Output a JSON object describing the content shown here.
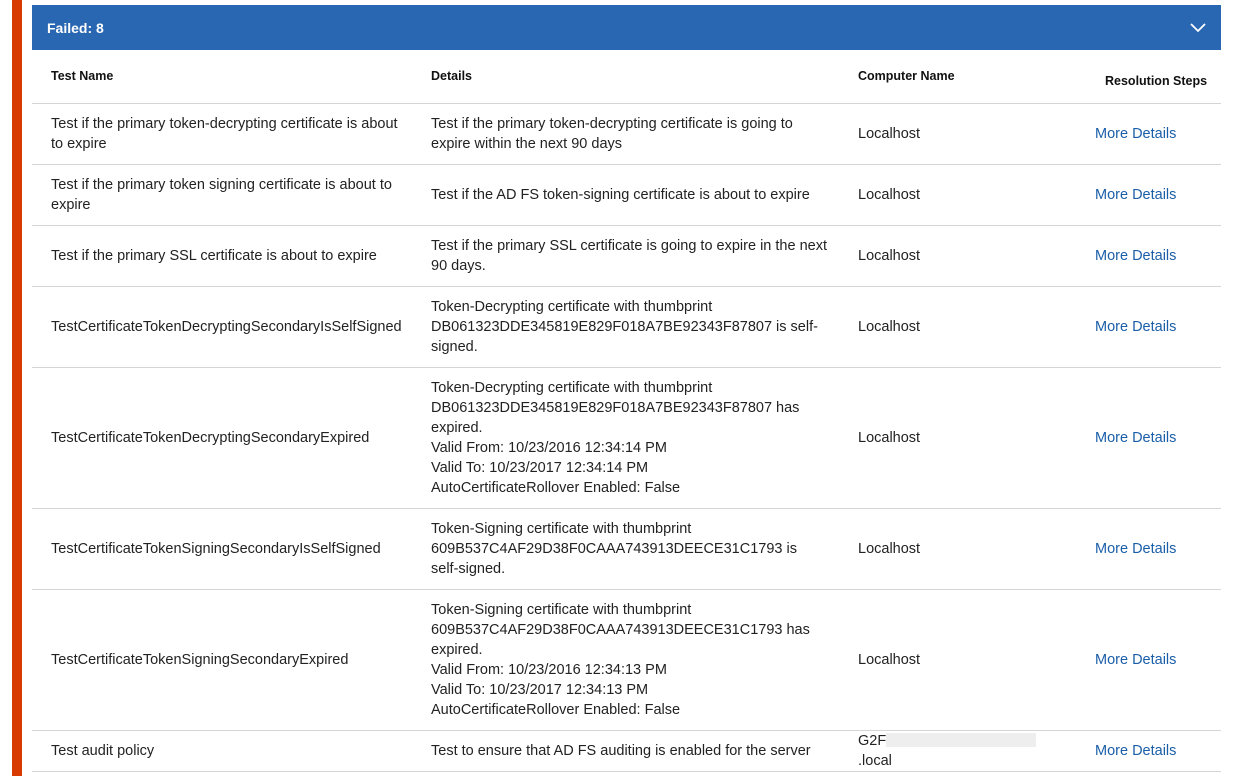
{
  "panel": {
    "title": "Failed: 8"
  },
  "columns": {
    "test_name": "Test Name",
    "details": "Details",
    "computer_name": "Computer Name",
    "resolution_steps": "Resolution Steps"
  },
  "rows": [
    {
      "test_name": "Test if the primary token-decrypting certificate is about to expire",
      "details": [
        "Test if the primary token-decrypting certificate is going to expire within the next 90 days"
      ],
      "computer": "Localhost",
      "link": "More Details"
    },
    {
      "test_name": "Test if the primary token signing certificate is about to expire",
      "details": [
        "Test if the AD FS token-signing certificate is about to expire"
      ],
      "computer": "Localhost",
      "link": "More Details"
    },
    {
      "test_name": "Test if the primary SSL certificate is about to expire",
      "details": [
        "Test if the primary SSL certificate is going to expire in the next 90 days."
      ],
      "computer": "Localhost",
      "link": "More Details"
    },
    {
      "test_name": "TestCertificateTokenDecryptingSecondaryIsSelfSigned",
      "details": [
        "Token-Decrypting certificate with thumbprint DB061323DDE345819E829F018A7BE92343F87807 is self-signed."
      ],
      "computer": "Localhost",
      "link": "More Details"
    },
    {
      "test_name": "TestCertificateTokenDecryptingSecondaryExpired",
      "details": [
        "Token-Decrypting certificate with thumbprint DB061323DDE345819E829F018A7BE92343F87807 has expired.",
        "Valid From: 10/23/2016 12:34:14 PM",
        "Valid To: 10/23/2017 12:34:14 PM",
        "AutoCertificateRollover Enabled: False"
      ],
      "computer": "Localhost",
      "link": "More Details"
    },
    {
      "test_name": "TestCertificateTokenSigningSecondaryIsSelfSigned",
      "details": [
        "Token-Signing certificate with thumbprint 609B537C4AF29D38F0CAAA743913DEECE31C1793 is self-signed."
      ],
      "computer": "Localhost",
      "link": "More Details"
    },
    {
      "test_name": "TestCertificateTokenSigningSecondaryExpired",
      "details": [
        "Token-Signing certificate with thumbprint 609B537C4AF29D38F0CAAA743913DEECE31C1793 has expired.",
        "Valid From: 10/23/2016 12:34:13 PM",
        "Valid To: 10/23/2017 12:34:13 PM",
        "AutoCertificateRollover Enabled: False"
      ],
      "computer": "Localhost",
      "link": "More Details"
    },
    {
      "test_name": "Test audit policy",
      "details": [
        "Test to ensure that AD FS auditing is enabled for the server"
      ],
      "computer_prefix": "G2F",
      "computer_suffix": ".local",
      "link": "More Details"
    }
  ]
}
